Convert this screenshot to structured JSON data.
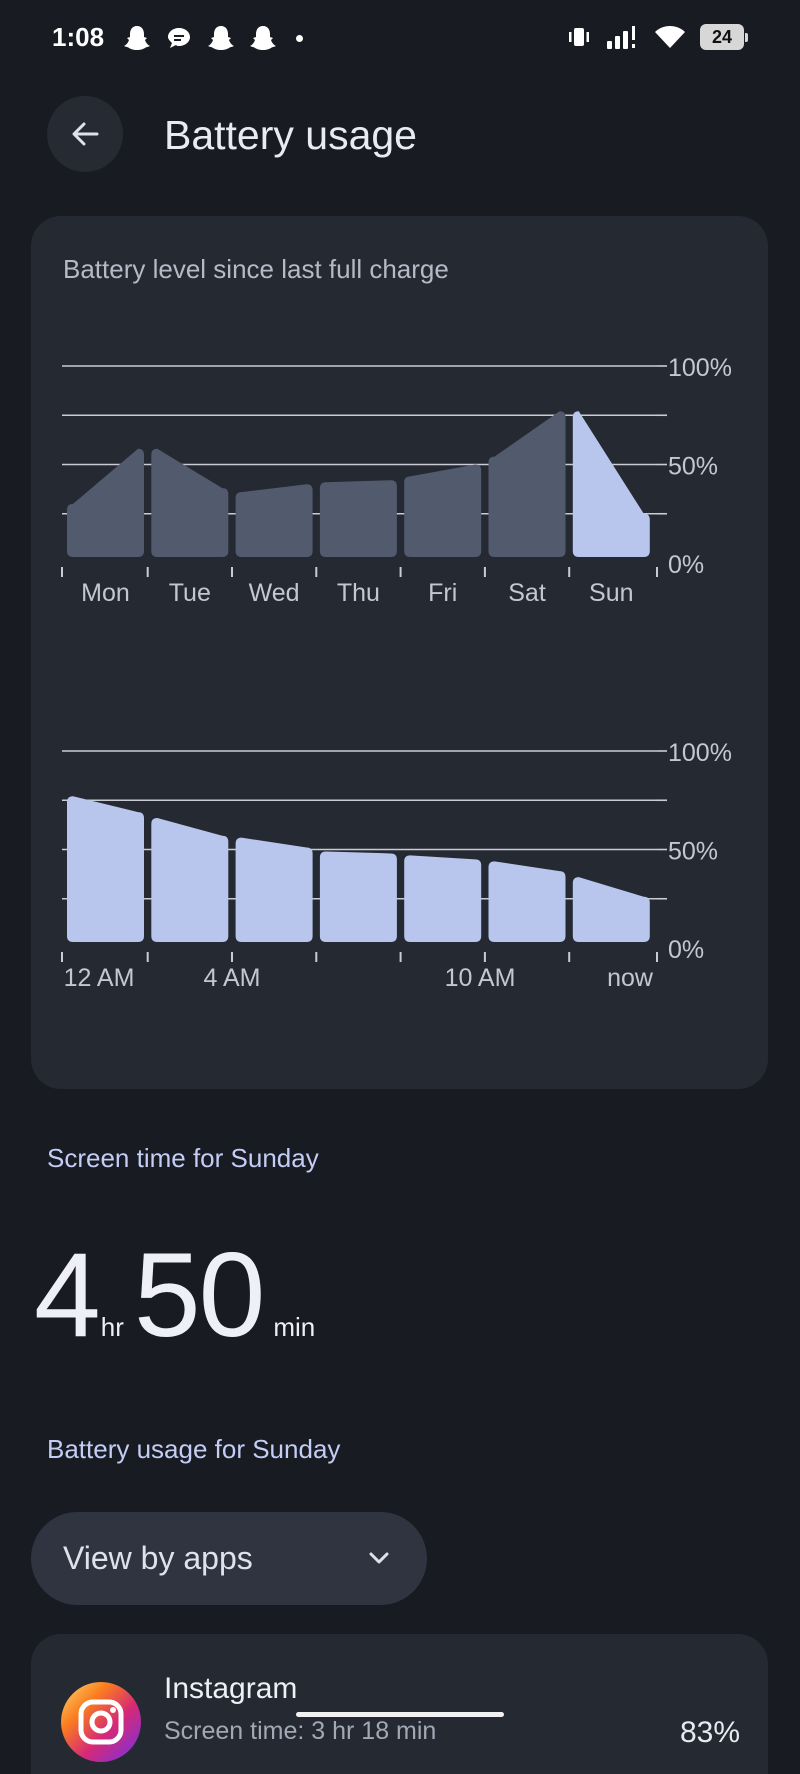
{
  "status_bar": {
    "time": "1:08",
    "notification_icons": [
      "snapchat-icon",
      "messages-icon",
      "snapchat-icon",
      "snapchat-icon",
      "more-dot-icon"
    ],
    "system_icons": [
      "vibrate-icon",
      "signal-icon",
      "wifi-icon",
      "battery-icon"
    ],
    "battery_level": "24"
  },
  "header": {
    "title": "Battery usage",
    "back_icon": "arrow-back-icon"
  },
  "battery_card": {
    "subtitle": "Battery level since last full charge"
  },
  "chart_data": [
    {
      "type": "bar",
      "title": "Battery level since last full charge",
      "categories": [
        "Mon",
        "Tue",
        "Wed",
        "Thu",
        "Fri",
        "Sat",
        "Sun"
      ],
      "segments": [
        [
          30,
          58
        ],
        [
          58,
          38
        ],
        [
          36,
          40
        ],
        [
          41,
          42
        ],
        [
          44,
          50
        ],
        [
          54,
          77
        ],
        [
          77,
          25
        ]
      ],
      "selected": "Sun",
      "yticks": [
        "100%",
        "50%",
        "0%"
      ],
      "ylim": [
        0,
        100
      ],
      "grid": true,
      "colors": {
        "normal": "#525a6e",
        "selected": "#b8c6ee",
        "grid": "#c9ccd4",
        "label": "#c3c7d1"
      }
    },
    {
      "type": "bar",
      "categories": [
        "12 AM",
        "4 AM",
        "10 AM",
        "now"
      ],
      "segments": [
        [
          77,
          69
        ],
        [
          66,
          57
        ],
        [
          56,
          51
        ],
        [
          49,
          48
        ],
        [
          47,
          45
        ],
        [
          44,
          39
        ],
        [
          36,
          26
        ]
      ],
      "yticks": [
        "100%",
        "50%",
        "0%"
      ],
      "ylim": [
        0,
        100
      ],
      "grid": true,
      "colors": {
        "bar": "#b8c6ee",
        "grid": "#c9ccd4",
        "label": "#c3c7d1"
      }
    }
  ],
  "screen_time": {
    "heading": "Screen time for Sunday",
    "hours": "4",
    "hours_unit": "hr",
    "minutes": "50",
    "minutes_unit": "min"
  },
  "usage": {
    "heading": "Battery usage for Sunday",
    "dropdown_label": "View by apps"
  },
  "apps": [
    {
      "name": "Instagram",
      "subtext": "Screen time: 3 hr 18 min",
      "percent": "83%",
      "icon": "instagram-icon"
    }
  ]
}
